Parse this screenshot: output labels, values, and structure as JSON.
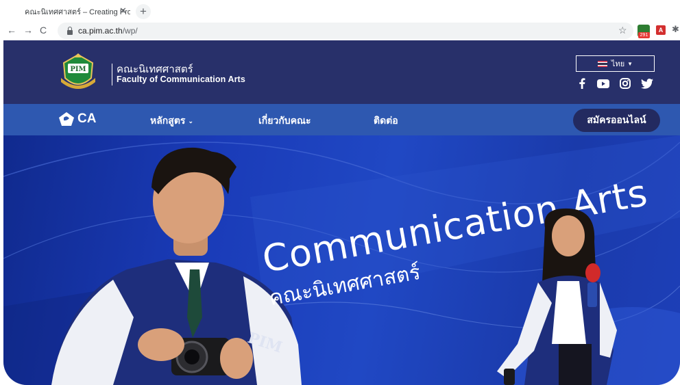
{
  "browser": {
    "tab_title": "คณะนิเทศศาสตร์ – Creating Profes",
    "tab_close": "✕",
    "new_tab": "+",
    "url_host": "ca.pim.ac.th",
    "url_path": "/wp/",
    "extension_badge": "291",
    "pdf_ext": "A"
  },
  "header": {
    "crest_text": "PIM",
    "brand_th": "คณะนิเทศศาสตร์",
    "brand_en": "Faculty of Communication Arts",
    "language": "ไทย",
    "social": [
      "facebook-icon",
      "youtube-icon",
      "instagram-icon",
      "twitter-icon"
    ]
  },
  "nav": {
    "logo_text": "CA",
    "items": [
      {
        "label": "หลักสูตร",
        "has_dropdown": true
      },
      {
        "label": "เกี่ยวกับคณะ",
        "has_dropdown": false
      },
      {
        "label": "ติดต่อ",
        "has_dropdown": false
      }
    ],
    "apply_label": "สมัครออนไลน์"
  },
  "hero": {
    "title": "Communication Arts",
    "subtitle": "คณะนิเทศศาสตร์",
    "jacket_text": "PIM"
  },
  "colors": {
    "header_bg": "#28306a",
    "nav_bg": "#2e58b0",
    "apply_bg": "#232a60",
    "hero_bg": "#1a3bb8"
  }
}
